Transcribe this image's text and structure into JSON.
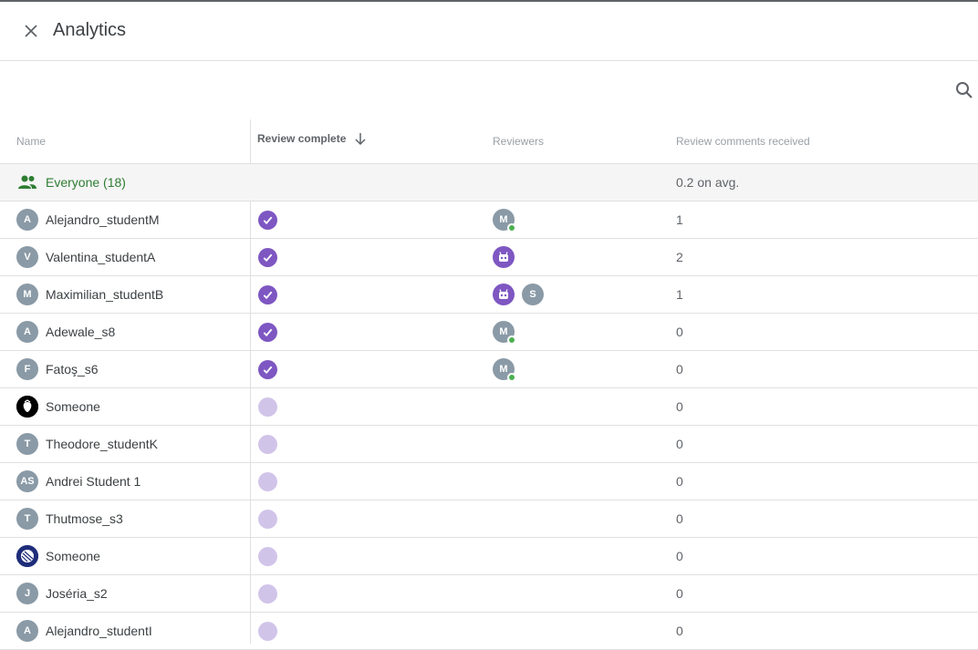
{
  "header": {
    "title": "Analytics"
  },
  "table": {
    "columns": {
      "name": "Name",
      "review_complete": "Review complete",
      "reviewers": "Reviewers",
      "comments": "Review comments received"
    },
    "everyone": {
      "label": "Everyone (18)",
      "comments": "0.2 on avg."
    },
    "rows": [
      {
        "initial": "A",
        "name": "Alejandro_studentM",
        "complete": true,
        "reviewers": [
          {
            "label": "M",
            "type": "grey",
            "online": true
          }
        ],
        "comments": "1"
      },
      {
        "initial": "V",
        "name": "Valentina_studentA",
        "complete": true,
        "reviewers": [
          {
            "label": "",
            "type": "purple-bot",
            "online": false
          }
        ],
        "comments": "2"
      },
      {
        "initial": "M",
        "name": "Maximilian_studentB",
        "complete": true,
        "reviewers": [
          {
            "label": "",
            "type": "purple-bot",
            "online": false
          },
          {
            "label": "S",
            "type": "grey",
            "online": false
          }
        ],
        "comments": "1"
      },
      {
        "initial": "A",
        "name": "Adewale_s8",
        "complete": true,
        "reviewers": [
          {
            "label": "M",
            "type": "grey",
            "online": true
          }
        ],
        "comments": "0"
      },
      {
        "initial": "F",
        "name": "Fatoş_s6",
        "complete": true,
        "reviewers": [
          {
            "label": "M",
            "type": "grey",
            "online": true
          }
        ],
        "comments": "0"
      },
      {
        "initial": "",
        "avatar": "strawberry-avatar",
        "name": "Someone",
        "complete": false,
        "reviewers": [],
        "comments": "0"
      },
      {
        "initial": "T",
        "name": "Theodore_studentK",
        "complete": false,
        "reviewers": [],
        "comments": "0"
      },
      {
        "initial": "AS",
        "name": "Andrei Student 1",
        "complete": false,
        "reviewers": [],
        "comments": "0"
      },
      {
        "initial": "T",
        "name": "Thutmose_s3",
        "complete": false,
        "reviewers": [],
        "comments": "0"
      },
      {
        "initial": "",
        "avatar": "ball-avatar",
        "name": "Someone",
        "complete": false,
        "reviewers": [],
        "comments": "0"
      },
      {
        "initial": "J",
        "name": "Joséria_s2",
        "complete": false,
        "reviewers": [],
        "comments": "0"
      },
      {
        "initial": "A",
        "name": "Alejandro_studentI",
        "complete": false,
        "reviewers": [],
        "comments": "0"
      }
    ]
  },
  "colors": {
    "accent_purple": "#7e57c2",
    "pending_purple": "#d1c4e9",
    "everyone_green": "#2e7d32",
    "online_green": "#4caf50",
    "avatar_grey": "#8a9aa6"
  }
}
